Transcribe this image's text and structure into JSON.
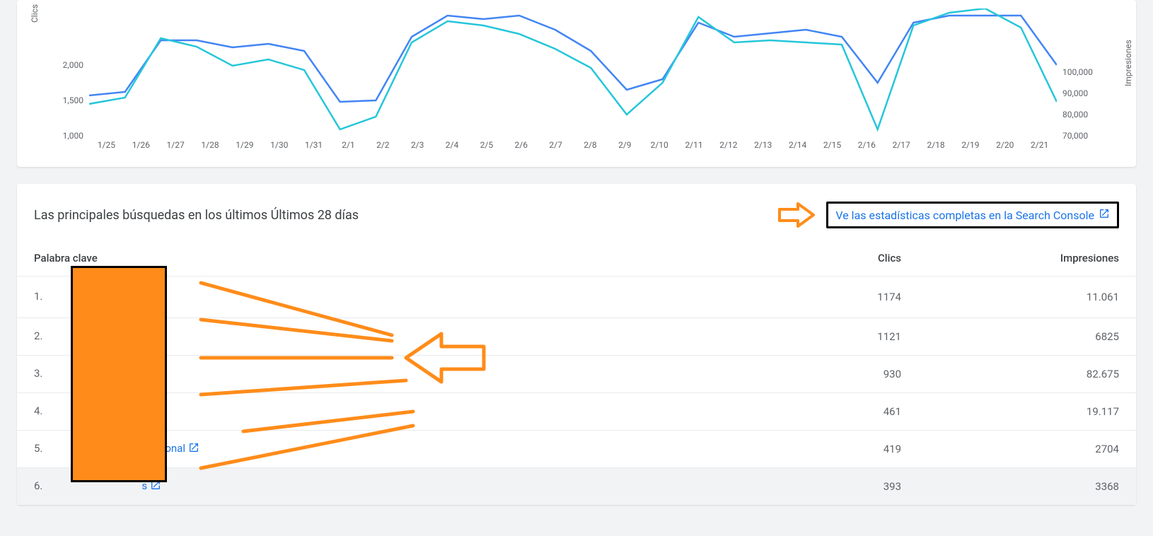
{
  "chart_data": {
    "type": "line",
    "categories": [
      "1/25",
      "1/26",
      "1/27",
      "1/28",
      "1/29",
      "1/30",
      "1/31",
      "2/1",
      "2/2",
      "2/3",
      "2/4",
      "2/5",
      "2/6",
      "2/7",
      "2/8",
      "2/9",
      "2/10",
      "2/11",
      "2/12",
      "2/13",
      "2/14",
      "2/15",
      "2/16",
      "2/17",
      "2/18",
      "2/19",
      "2/20",
      "2/21"
    ],
    "series": [
      {
        "name": "Clics",
        "color": "#4285f4",
        "values": [
          1570,
          1620,
          2350,
          2350,
          2250,
          2300,
          2200,
          1480,
          1500,
          2400,
          2700,
          2650,
          2700,
          2500,
          2200,
          1650,
          1800,
          2600,
          2400,
          2450,
          2500,
          2400,
          1750,
          2600,
          2700,
          2700,
          2700,
          2000
        ]
      },
      {
        "name": "Impresiones",
        "color": "#26c6da",
        "values": [
          85000,
          88000,
          116000,
          112000,
          103000,
          106000,
          101000,
          73000,
          79000,
          114000,
          124000,
          122000,
          118000,
          111000,
          102000,
          80000,
          95000,
          126000,
          114000,
          115000,
          114000,
          113000,
          73000,
          122000,
          128000,
          130000,
          121000,
          86000
        ]
      }
    ],
    "yaxis_left": {
      "label": "Clics",
      "ticks": [
        2000,
        1500,
        1000
      ],
      "min": 1000,
      "max": 2800
    },
    "yaxis_right": {
      "label": "Impresiones",
      "ticks": [
        100000,
        90000,
        80000,
        70000
      ],
      "tick_labels": [
        "100,000",
        "90,000",
        "80,000",
        "70,000"
      ],
      "min": 70000,
      "max": 130000
    }
  },
  "top_searches": {
    "title": "Las principales búsquedas en los últimos Últimos 28 días",
    "link_text": "Ve las estadísticas completas en la Search Console",
    "columns": {
      "keyword": "Palabra clave",
      "clicks": "Clics",
      "impressions": "Impresiones"
    },
    "rows": [
      {
        "rank": "1.",
        "keyword": "",
        "keyword_suffix": "",
        "clicks": "1174",
        "impressions": "11.061",
        "dotted_box": true
      },
      {
        "rank": "2.",
        "keyword": "",
        "keyword_suffix": "",
        "clicks": "1121",
        "impressions": "6825"
      },
      {
        "rank": "3.",
        "keyword": "",
        "keyword_suffix": "",
        "clicks": "930",
        "impressions": "82.675"
      },
      {
        "rank": "4.",
        "keyword": "",
        "keyword_suffix": "",
        "clicks": "461",
        "impressions": "19.117"
      },
      {
        "rank": "5.",
        "keyword": "",
        "keyword_suffix": "ofesional",
        "clicks": "419",
        "impressions": "2704"
      },
      {
        "rank": "6.",
        "keyword": "",
        "keyword_suffix": "s",
        "clicks": "393",
        "impressions": "3368",
        "hover": true
      }
    ]
  },
  "annotations": {
    "redaction_box": true,
    "right_arrow_to_link": true,
    "left_arrow_to_keywords": true
  }
}
